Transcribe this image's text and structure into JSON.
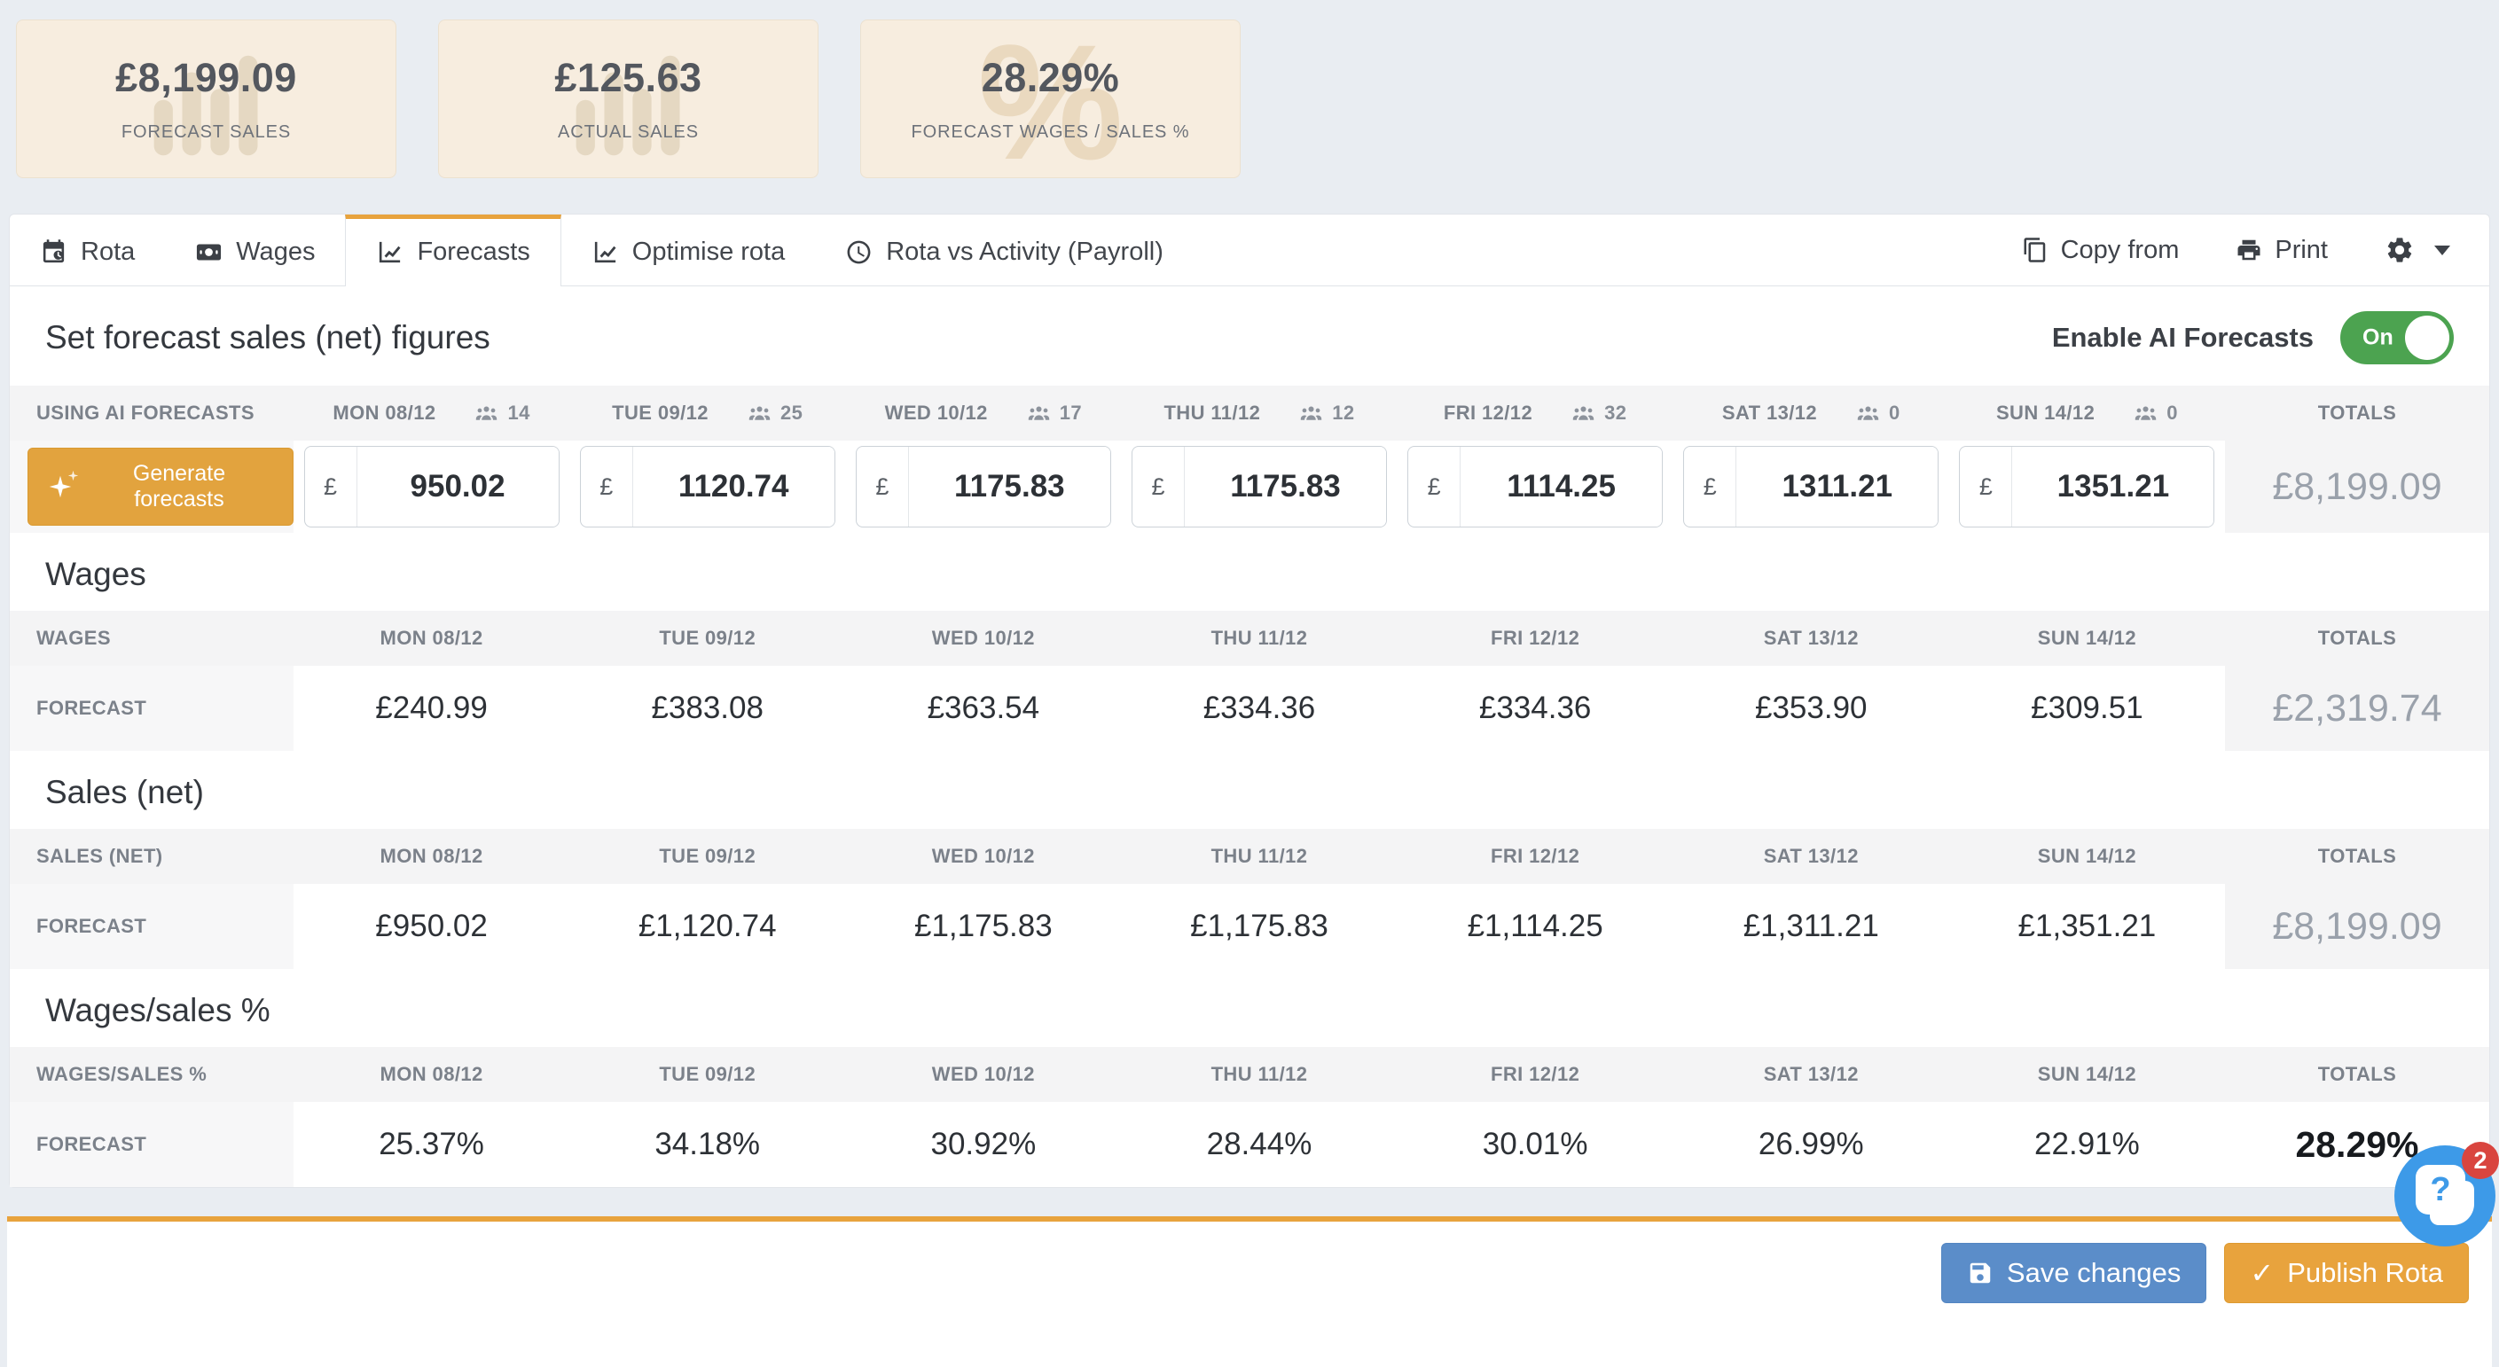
{
  "stat_cards": [
    {
      "value": "£8,199.09",
      "label": "FORECAST SALES"
    },
    {
      "value": "£125.63",
      "label": "ACTUAL SALES"
    },
    {
      "value": "28.29%",
      "label": "FORECAST WAGES / SALES %"
    }
  ],
  "tabs": {
    "rota": "Rota",
    "wages": "Wages",
    "forecasts": "Forecasts",
    "optimise": "Optimise rota",
    "rota_vs_activity": "Rota vs Activity (Payroll)",
    "copy_from": "Copy from",
    "print": "Print"
  },
  "heading": {
    "title": "Set forecast sales (net) figures",
    "toggle_label": "Enable AI Forecasts",
    "toggle_state": "On"
  },
  "table": {
    "ai_header": "USING AI FORECASTS",
    "totals_header": "TOTALS",
    "generate_label": "Generate forecasts",
    "currency": "£",
    "days": [
      {
        "label": "MON 08/12",
        "count": "14"
      },
      {
        "label": "TUE 09/12",
        "count": "25"
      },
      {
        "label": "WED 10/12",
        "count": "17"
      },
      {
        "label": "THU 11/12",
        "count": "12"
      },
      {
        "label": "FRI 12/12",
        "count": "32"
      },
      {
        "label": "SAT 13/12",
        "count": "0"
      },
      {
        "label": "SUN 14/12",
        "count": "0"
      }
    ],
    "inputs": [
      "950.02",
      "1120.74",
      "1175.83",
      "1175.83",
      "1114.25",
      "1311.21",
      "1351.21"
    ],
    "inputs_total": "£8,199.09"
  },
  "sections": [
    {
      "title": "Wages",
      "header": "WAGES",
      "row_label": "FORECAST",
      "values": [
        "£240.99",
        "£383.08",
        "£363.54",
        "£334.36",
        "£334.36",
        "£353.90",
        "£309.51"
      ],
      "total": "£2,319.74"
    },
    {
      "title": "Sales (net)",
      "header": "SALES (NET)",
      "row_label": "FORECAST",
      "values": [
        "£950.02",
        "£1,120.74",
        "£1,175.83",
        "£1,175.83",
        "£1,114.25",
        "£1,311.21",
        "£1,351.21"
      ],
      "total": "£8,199.09"
    },
    {
      "title": "Wages/sales %",
      "header": "WAGES/SALES %",
      "row_label": "FORECAST",
      "values": [
        "25.37%",
        "34.18%",
        "30.92%",
        "28.44%",
        "30.01%",
        "26.99%",
        "22.91%"
      ],
      "total": "28.29%"
    }
  ],
  "footer": {
    "save": "Save changes",
    "publish": "Publish Rota"
  },
  "chat": {
    "badge": "2"
  },
  "colors": {
    "accent_orange": "#e8a33d",
    "toggle_green": "#4ca350",
    "save_blue": "#5b8dc9",
    "chat_blue": "#3d9ae8",
    "badge_red": "#d9453f",
    "card_beige": "#f7eddf"
  }
}
